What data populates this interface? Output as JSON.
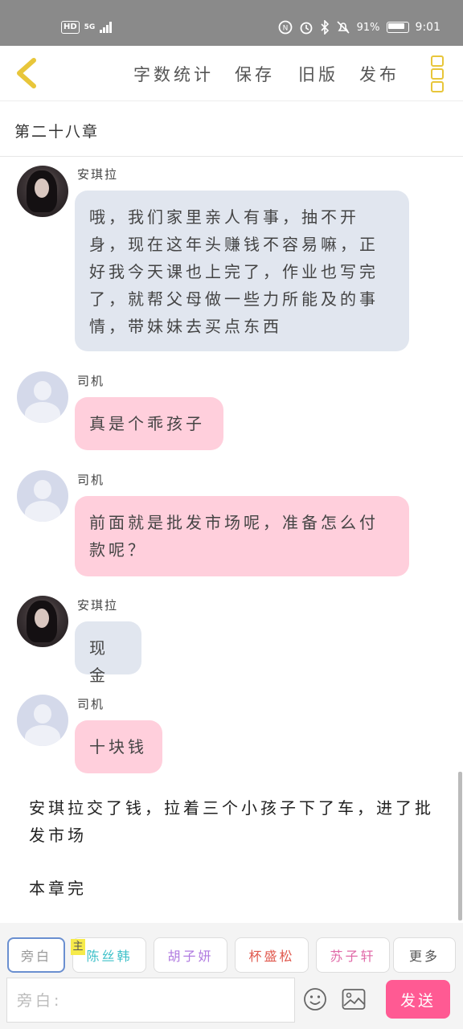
{
  "status": {
    "hd": "HD",
    "network": "5G",
    "battery_percent": "91%",
    "time": "9:01"
  },
  "toolbar": {
    "word_count": "字数统计",
    "save": "保存",
    "old_version": "旧版",
    "publish": "发布"
  },
  "chapter_title": "第二十八章",
  "messages": [
    {
      "name": "安琪拉",
      "text": "哦，我们家里亲人有事，抽不开身，现在这年头赚钱不容易嘛，正好我今天课也上完了，作业也写完了，就帮父母做一些力所能及的事情，带妹妹去买点东西"
    },
    {
      "name": "司机",
      "text": "真是个乖孩子"
    },
    {
      "name": "司机",
      "text": "前面就是批发市场呢，准备怎么付款呢？"
    },
    {
      "name": "安琪拉",
      "text": "现金"
    },
    {
      "name": "司机",
      "text": "十块钱"
    }
  ],
  "narration": "安琪拉交了钱，拉着三个小孩子下了车，进了批发市场",
  "chapter_end": "本章完",
  "characters": [
    {
      "label": "旁白",
      "color": "#999999"
    },
    {
      "label": "陈丝韩",
      "color": "#3fc1c9",
      "tag": "主"
    },
    {
      "label": "胡子妍",
      "color": "#b07be0"
    },
    {
      "label": "杯盛松",
      "color": "#e05a4f"
    },
    {
      "label": "苏子轩",
      "color": "#e06aa8"
    },
    {
      "label": "更多",
      "color": "#555555"
    }
  ],
  "input": {
    "placeholder": "旁白:"
  },
  "send_label": "发送",
  "colors": {
    "accent": "#ff5a93",
    "back_arrow": "#e8c63a",
    "bubble_blue": "#e1e6ef",
    "bubble_pink": "#ffcfdc"
  }
}
